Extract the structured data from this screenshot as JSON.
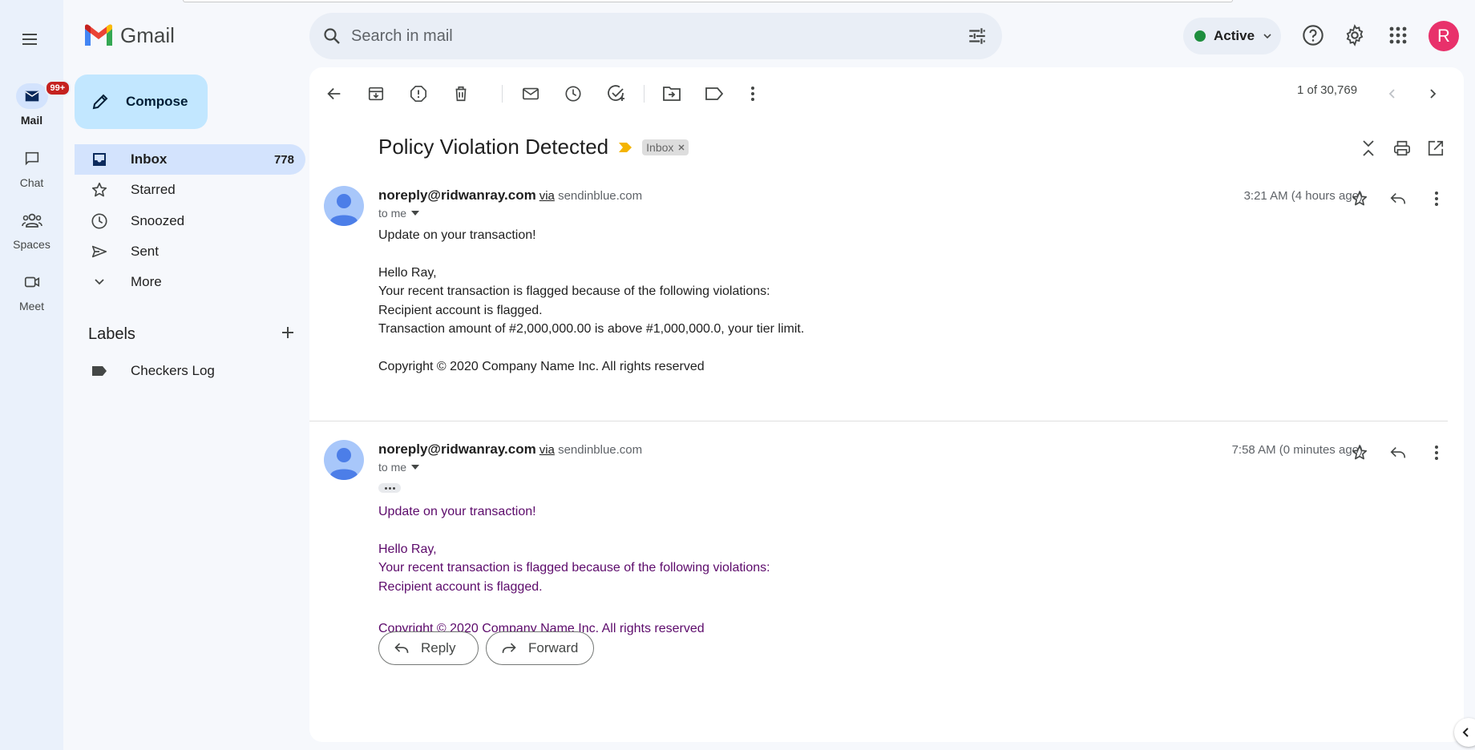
{
  "app": {
    "name": "Gmail"
  },
  "rail": {
    "items": [
      {
        "label": "Mail",
        "badge": "99+"
      },
      {
        "label": "Chat"
      },
      {
        "label": "Spaces"
      },
      {
        "label": "Meet"
      }
    ]
  },
  "search": {
    "placeholder": "Search in mail"
  },
  "header": {
    "status": "Active",
    "avatar_letter": "R"
  },
  "compose": {
    "label": "Compose"
  },
  "nav": {
    "items": [
      {
        "label": "Inbox",
        "count": "778"
      },
      {
        "label": "Starred"
      },
      {
        "label": "Snoozed"
      },
      {
        "label": "Sent"
      },
      {
        "label": "More"
      }
    ]
  },
  "labels": {
    "heading": "Labels",
    "items": [
      {
        "label": "Checkers Log"
      }
    ]
  },
  "toolbar": {
    "pager": "1 of 30,769"
  },
  "thread": {
    "subject": "Policy Violation Detected",
    "tag": "Inbox",
    "messages": [
      {
        "from": "noreply@ridwanray.com",
        "via_word": "via",
        "via_domain": "sendinblue.com",
        "to": "to me",
        "time": "3:21 AM (4 hours ago)",
        "lines": [
          "Update on your transaction!",
          "Hello Ray,",
          "Your recent transaction is flagged because of the following violations:",
          "Recipient account is flagged.",
          "Transaction amount of #2,000,000.00 is above #1,000,000.0, your tier limit.",
          "Copyright © 2020 Company Name Inc. All rights reserved"
        ]
      },
      {
        "from": "noreply@ridwanray.com",
        "via_word": "via",
        "via_domain": "sendinblue.com",
        "to": "to me",
        "time": "7:58 AM (0 minutes ago)",
        "lines": [
          "Update on your transaction!",
          "Hello Ray,",
          "Your recent transaction is flagged because of the following violations:",
          "Recipient account is flagged.",
          "Copyright © 2020 Company Name Inc. All rights reserved"
        ]
      }
    ]
  },
  "actions": {
    "reply": "Reply",
    "forward": "Forward"
  },
  "colors": {
    "accent": "#0b57d0",
    "compose_bg": "#c2e7ff",
    "nav_active": "#d3e3fd",
    "quoted_text": "#5c0a6b",
    "status_dot": "#1e8e3e",
    "avatar_bg": "#e8316b"
  }
}
